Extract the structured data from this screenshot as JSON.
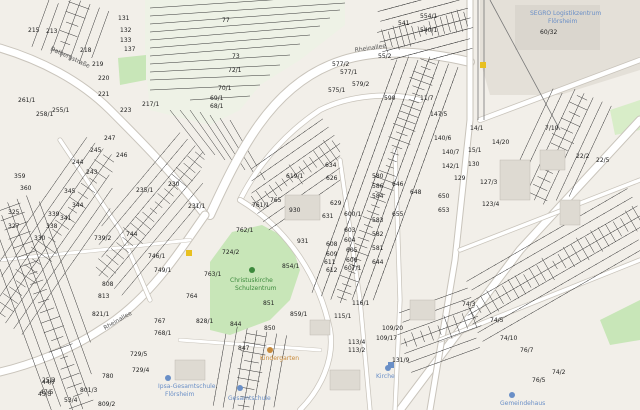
{
  "map": {
    "colors": {
      "background": "#f2efe9",
      "road": "#ffffff",
      "road_outline": "#c9c4bb",
      "parcel_line": "#333333",
      "park": "#c8e6b8",
      "park_light": "#d8edc8",
      "building": "#dedad2",
      "rail": "#777777",
      "poi_blue": "#6a8fc7",
      "poi_orange": "#c88a3a",
      "poi_green": "#3d8a3d"
    },
    "streets": [
      {
        "id": "rheinallee",
        "label": "Rheinallee"
      },
      {
        "id": "rheinallee-2",
        "label": "Rheinallee"
      },
      {
        "id": "dalbergstrasse",
        "label": "Dalbergstraße"
      }
    ],
    "pois": [
      {
        "id": "segro",
        "label": "SEGRO Logistikzentrum",
        "sub": "Flörsheim",
        "kind": "blue"
      },
      {
        "id": "christuskirche",
        "label": "Christuskirche",
        "sub": "Schulzentrum",
        "kind": "green"
      },
      {
        "id": "ips-gesamtschule",
        "label": "Ipsa-Gesamtschule",
        "sub": "Flörsheim",
        "kind": "blue"
      },
      {
        "id": "gesamtschule-2",
        "label": "Gesamtschule",
        "sub": "Flörsheim",
        "kind": "blue"
      },
      {
        "id": "kindergarten",
        "label": "Kindergarten",
        "sub": "",
        "kind": "orange"
      },
      {
        "id": "kirche-rheinallee",
        "label": "Kirche",
        "sub": "",
        "kind": "blue"
      },
      {
        "id": "gemeindehaus",
        "label": "Gemeindehaus",
        "sub": "",
        "kind": "blue"
      }
    ],
    "parcel_labels": [
      {
        "t": "77"
      },
      {
        "t": "72/1"
      },
      {
        "t": "73"
      },
      {
        "t": "70/1"
      },
      {
        "t": "69/1"
      },
      {
        "t": "68/1"
      },
      {
        "t": "131"
      },
      {
        "t": "132"
      },
      {
        "t": "133"
      },
      {
        "t": "137"
      },
      {
        "t": "218"
      },
      {
        "t": "219"
      },
      {
        "t": "215"
      },
      {
        "t": "213"
      },
      {
        "t": "220"
      },
      {
        "t": "221"
      },
      {
        "t": "223"
      },
      {
        "t": "217/1"
      },
      {
        "t": "261/1"
      },
      {
        "t": "255/1"
      },
      {
        "t": "258/1"
      },
      {
        "t": "247"
      },
      {
        "t": "246"
      },
      {
        "t": "245"
      },
      {
        "t": "244"
      },
      {
        "t": "243"
      },
      {
        "t": "359"
      },
      {
        "t": "360"
      },
      {
        "t": "345"
      },
      {
        "t": "344"
      },
      {
        "t": "341"
      },
      {
        "t": "339"
      },
      {
        "t": "338"
      },
      {
        "t": "325"
      },
      {
        "t": "327"
      },
      {
        "t": "330"
      },
      {
        "t": "235/1"
      },
      {
        "t": "230"
      },
      {
        "t": "231/1"
      },
      {
        "t": "749/1"
      },
      {
        "t": "746/1"
      },
      {
        "t": "739/2"
      },
      {
        "t": "744"
      },
      {
        "t": "767"
      },
      {
        "t": "764"
      },
      {
        "t": "768/1"
      },
      {
        "t": "828/1"
      },
      {
        "t": "844"
      },
      {
        "t": "847"
      },
      {
        "t": "850"
      },
      {
        "t": "851"
      },
      {
        "t": "859/1"
      },
      {
        "t": "761/1"
      },
      {
        "t": "762/1"
      },
      {
        "t": "724/2"
      },
      {
        "t": "763/1"
      },
      {
        "t": "765"
      },
      {
        "t": "930"
      },
      {
        "t": "931"
      },
      {
        "t": "854/1"
      },
      {
        "t": "619/1"
      },
      {
        "t": "634"
      },
      {
        "t": "626"
      },
      {
        "t": "629"
      },
      {
        "t": "631"
      },
      {
        "t": "600/1"
      },
      {
        "t": "603"
      },
      {
        "t": "604"
      },
      {
        "t": "605"
      },
      {
        "t": "606"
      },
      {
        "t": "607/1"
      },
      {
        "t": "608"
      },
      {
        "t": "609"
      },
      {
        "t": "611"
      },
      {
        "t": "612"
      },
      {
        "t": "580"
      },
      {
        "t": "586"
      },
      {
        "t": "584"
      },
      {
        "t": "583"
      },
      {
        "t": "582"
      },
      {
        "t": "581"
      },
      {
        "t": "644"
      },
      {
        "t": "646"
      },
      {
        "t": "648"
      },
      {
        "t": "650"
      },
      {
        "t": "653"
      },
      {
        "t": "655"
      },
      {
        "t": "116/1"
      },
      {
        "t": "115/1"
      },
      {
        "t": "113/4"
      },
      {
        "t": "113/2"
      },
      {
        "t": "109/20"
      },
      {
        "t": "109/17"
      },
      {
        "t": "131/9"
      },
      {
        "t": "74/3"
      },
      {
        "t": "74/5"
      },
      {
        "t": "74/10"
      },
      {
        "t": "74/2"
      },
      {
        "t": "76/7"
      },
      {
        "t": "25/2"
      },
      {
        "t": "47/5"
      },
      {
        "t": "76/5"
      },
      {
        "t": "11/7"
      },
      {
        "t": "14/1"
      },
      {
        "t": "14/20"
      },
      {
        "t": "15/1"
      },
      {
        "t": "7/10"
      },
      {
        "t": "22/2"
      },
      {
        "t": "22/5"
      },
      {
        "t": "60/32"
      },
      {
        "t": "55/2"
      },
      {
        "t": "554/1"
      },
      {
        "t": "541"
      },
      {
        "t": "540/1"
      },
      {
        "t": "577/2"
      },
      {
        "t": "577/1"
      },
      {
        "t": "579/2"
      },
      {
        "t": "575/1"
      },
      {
        "t": "590"
      },
      {
        "t": "147/5"
      },
      {
        "t": "140/6"
      },
      {
        "t": "140/7"
      },
      {
        "t": "142/1"
      },
      {
        "t": "130"
      },
      {
        "t": "129"
      },
      {
        "t": "127/3"
      },
      {
        "t": "123/4"
      },
      {
        "t": "821/1"
      },
      {
        "t": "813"
      },
      {
        "t": "808"
      },
      {
        "t": "729/5"
      },
      {
        "t": "729/4"
      },
      {
        "t": "780"
      },
      {
        "t": "44/7"
      },
      {
        "t": "45/3"
      },
      {
        "t": "53/4"
      },
      {
        "t": "801/3"
      },
      {
        "t": "809/2"
      }
    ]
  }
}
